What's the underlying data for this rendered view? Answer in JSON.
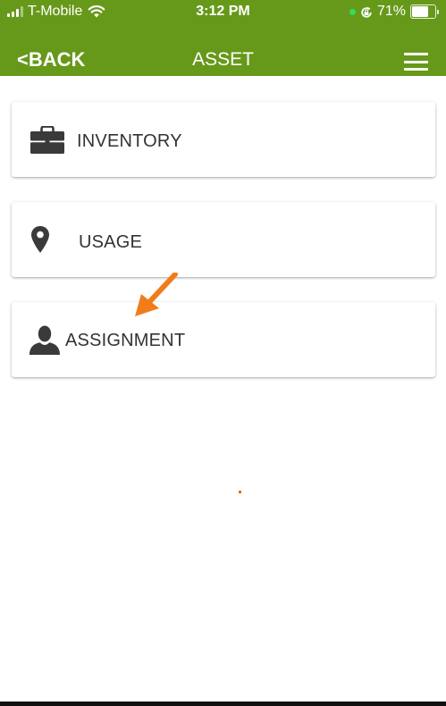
{
  "status_bar": {
    "carrier": "T-Mobile",
    "time": "3:12 PM",
    "battery_percent_label": "71%",
    "battery_level": 0.71,
    "icons": [
      "signal-icon",
      "wifi-icon",
      "location-dot-icon",
      "rotation-lock-icon",
      "battery-icon"
    ]
  },
  "nav": {
    "back_label": "<BACK",
    "title": "ASSET",
    "menu_icon": "hamburger-menu-icon"
  },
  "menu_items": [
    {
      "label": "INVENTORY",
      "icon": "briefcase-icon"
    },
    {
      "label": "USAGE",
      "icon": "location-pin-icon"
    },
    {
      "label": "ASSIGNMENT",
      "icon": "person-icon"
    }
  ],
  "annotation": {
    "icon": "orange-arrow-icon",
    "color": "#f07d1a"
  },
  "colors": {
    "header": "#66991a",
    "label": "#333333",
    "icon": "#3a3a3a",
    "accent": "#f07d1a"
  }
}
